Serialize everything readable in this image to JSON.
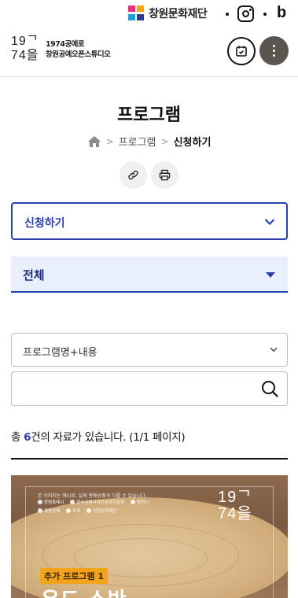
{
  "utility": {
    "foundation_name": "창원문화재단"
  },
  "header": {
    "brand_logo_line1": "19ᄀ",
    "brand_logo_line2": "74을",
    "brand_name_line1": "1974공예로",
    "brand_name_line2": "창원공예오픈스튜디오"
  },
  "page": {
    "title": "프로그램",
    "breadcrumb": [
      "프로그램",
      "신청하기"
    ]
  },
  "filters": {
    "apply_select": "신청하기",
    "category_select": "전체",
    "search_field_select": "프로그램명+내용",
    "search_value": "",
    "search_placeholder": ""
  },
  "results": {
    "prefix": "총 ",
    "count": "6",
    "suffix": "건의 자료가 있습니다. (1/1 페이지)"
  },
  "poster": {
    "note": "본 이미지는 예시로, 실제 판매상품과 다를 수 있습니다.",
    "sponsors": [
      "창원특례시",
      "한국공예디자인문화진흥원",
      "창원시",
      "창원공예",
      "주최",
      "창원문화재단"
    ],
    "logo_line1": "19ᄀ",
    "logo_line2": "74을",
    "badge": "추가 프로그램 1",
    "title": "우드 소반"
  },
  "colors": {
    "accent": "#2942ab",
    "select_bg": "#eaf0fb",
    "menu_btn": "#5b5550",
    "badge": "#f3a21c"
  },
  "icons": {
    "home": "home-icon",
    "link": "link-icon",
    "print": "print-icon",
    "calendar": "calendar-icon",
    "menu": "more-vertical-icon",
    "search": "search-icon",
    "instagram": "instagram-icon",
    "blog": "blog-icon"
  }
}
